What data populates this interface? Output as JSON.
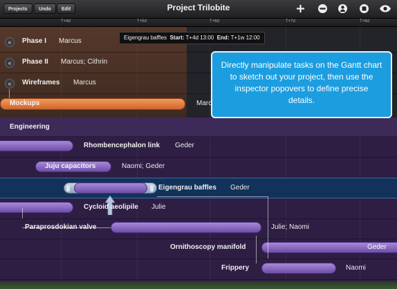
{
  "toolbar": {
    "projects_label": "Projects",
    "undo_label": "Undo",
    "edit_label": "Edit",
    "title": "Project Trilobite",
    "icons": [
      "plus-icon",
      "minus-circle-icon",
      "person-icon",
      "stop-icon",
      "eye-icon"
    ]
  },
  "ruler": {
    "ticks": [
      "T+4d",
      "T+5d",
      "T+6d",
      "T+7d",
      "T+8d"
    ]
  },
  "selection_info": {
    "task": "Eigengrau baffles",
    "start_label": "Start:",
    "start_value": "T+4d 13:00",
    "end_label": "End:",
    "end_value": "T+1w 12:00"
  },
  "callout": {
    "text": "Directly manipulate tasks on the Gantt chart to sketch out your project, then use the inspector popovers to define precise details."
  },
  "rows": [
    {
      "name": "Phase I",
      "assignee": "Marcus"
    },
    {
      "name": "Phase II",
      "assignee": "Marcus; Cithrin"
    },
    {
      "name": "Wireframes",
      "assignee": "Marcus"
    },
    {
      "name": "Mockups",
      "assignee": "Marc"
    },
    {
      "name": "Engineering",
      "assignee": ""
    },
    {
      "name": "Rhombencephalon link",
      "assignee": "Geder"
    },
    {
      "name": "Juju capacitors",
      "assignee": "Naomi; Geder"
    },
    {
      "name": "Eigengrau baffles",
      "assignee": "Geder"
    },
    {
      "name": "Cycloid aeolipile",
      "assignee": "Julie"
    },
    {
      "name": "Paraprosdokian valve",
      "assignee": "Julie; Naomi"
    },
    {
      "name": "Ornithoscopy manifold",
      "assignee": "Geder"
    },
    {
      "name": "Frippery",
      "assignee": "Naomi"
    }
  ]
}
